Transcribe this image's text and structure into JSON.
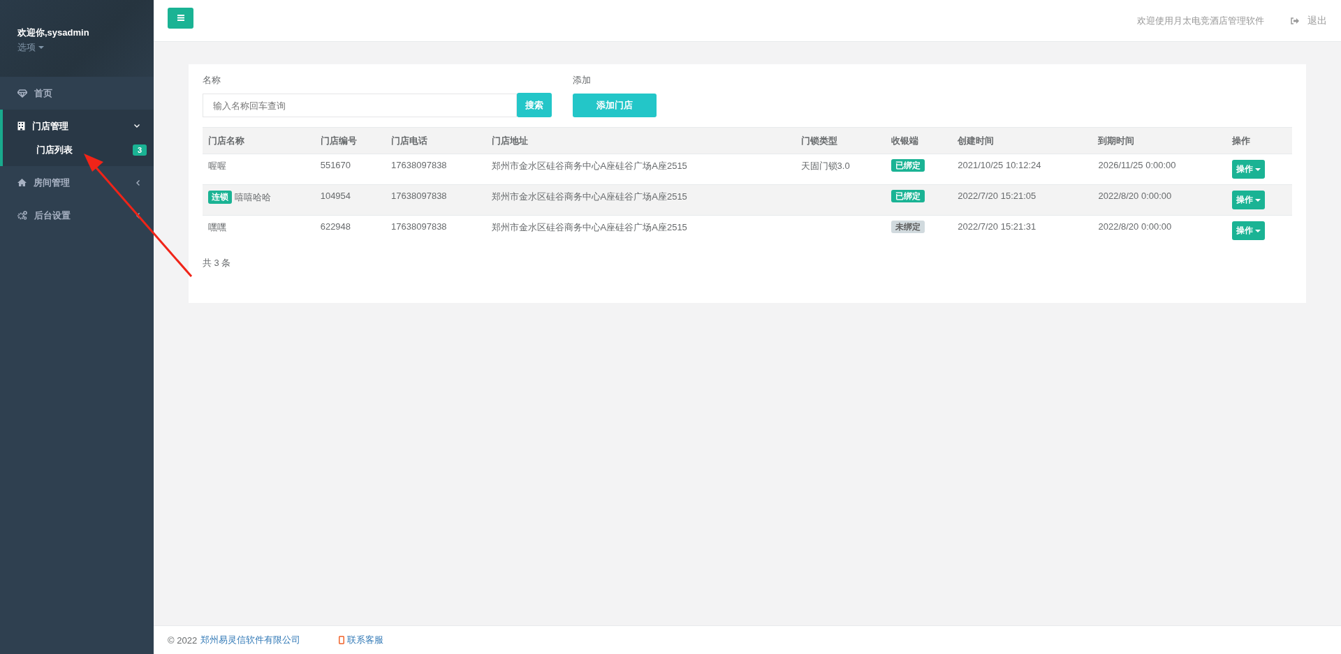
{
  "sidebar": {
    "user": "欢迎你,sysadmin",
    "options": "选项",
    "items": [
      {
        "label": "首页",
        "kind": "link",
        "selected": false
      },
      {
        "label": "门店管理",
        "kind": "menu",
        "selected": true,
        "expanded": true,
        "children": [
          {
            "label": "门店列表",
            "badge": "3",
            "selected": true
          }
        ]
      },
      {
        "label": "房间管理",
        "kind": "menu",
        "selected": false,
        "expanded": false
      },
      {
        "label": "后台设置",
        "kind": "menu",
        "selected": false,
        "expanded": false
      }
    ]
  },
  "topbar": {
    "welcome": "欢迎使用月太电竞酒店管理软件",
    "logout": "退出"
  },
  "search": {
    "label": "名称",
    "placeholder": "输入名称回车查询",
    "button": "搜索"
  },
  "add": {
    "label": "添加",
    "button": "添加门店"
  },
  "table": {
    "columns": [
      "门店名称",
      "门店编号",
      "门店电话",
      "门店地址",
      "门锁类型",
      "收银端",
      "创建时间",
      "到期时间",
      "操作"
    ],
    "rows": [
      {
        "name": "喔喔",
        "code": "551670",
        "phone": "17638097838",
        "address": "郑州市金水区硅谷商务中心A座硅谷广场A座2515",
        "lock": "天固门锁3.0",
        "cashier": "已绑定",
        "bound": true,
        "created": "2021/10/25 10:12:24",
        "expires": "2026/11/25 0:00:00",
        "action": "操作"
      },
      {
        "tag": "连锁",
        "name": "嘻嘻哈哈",
        "code": "104954",
        "phone": "17638097838",
        "address": "郑州市金水区硅谷商务中心A座硅谷广场A座2515",
        "cashier": "已绑定",
        "bound": true,
        "created": "2022/7/20 15:21:05",
        "expires": "2022/8/20 0:00:00",
        "action": "操作"
      },
      {
        "name": "嘿嘿",
        "code": "622948",
        "phone": "17638097838",
        "address": "郑州市金水区硅谷商务中心A座硅谷广场A座2515",
        "cashier": "未绑定",
        "bound": false,
        "created": "2022/7/20 15:21:31",
        "expires": "2022/8/20 0:00:00",
        "action": "操作"
      }
    ],
    "total": "共 3 条"
  },
  "footer": {
    "copyright": "© 2022",
    "company": "郑州易灵信软件有限公司",
    "contact": "联系客服"
  }
}
